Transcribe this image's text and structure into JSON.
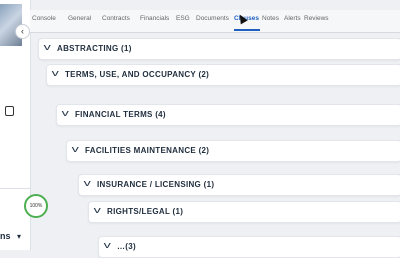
{
  "sidebar": {
    "collapse_icon": "chevron-left-icon",
    "copy_icon": "copy-icon",
    "progress_label": "100%",
    "owner_label": "ns"
  },
  "tabs": [
    {
      "label": "Console"
    },
    {
      "label": "General"
    },
    {
      "label": "Contracts"
    },
    {
      "label": "Financials"
    },
    {
      "label": "ESG"
    },
    {
      "label": "Documents"
    },
    {
      "label": "Clauses"
    },
    {
      "label": "Notes"
    },
    {
      "label": "Alerts"
    },
    {
      "label": "Reviews"
    }
  ],
  "active_tab": "Clauses",
  "sections": [
    {
      "title": "ABSTRACTING (1)"
    },
    {
      "title": "TERMS, USE, AND OCCUPANCY (2)"
    },
    {
      "title": "FINANCIAL TERMS (4)"
    },
    {
      "title": "FACILITIES MAINTENANCE (2)"
    },
    {
      "title": "INSURANCE / LICENSING (1)"
    },
    {
      "title": "RIGHTS/LEGAL (1)"
    },
    {
      "title": "…(3)"
    }
  ],
  "colors": {
    "accent": "#1e5fbf",
    "progress": "#4caf50"
  }
}
